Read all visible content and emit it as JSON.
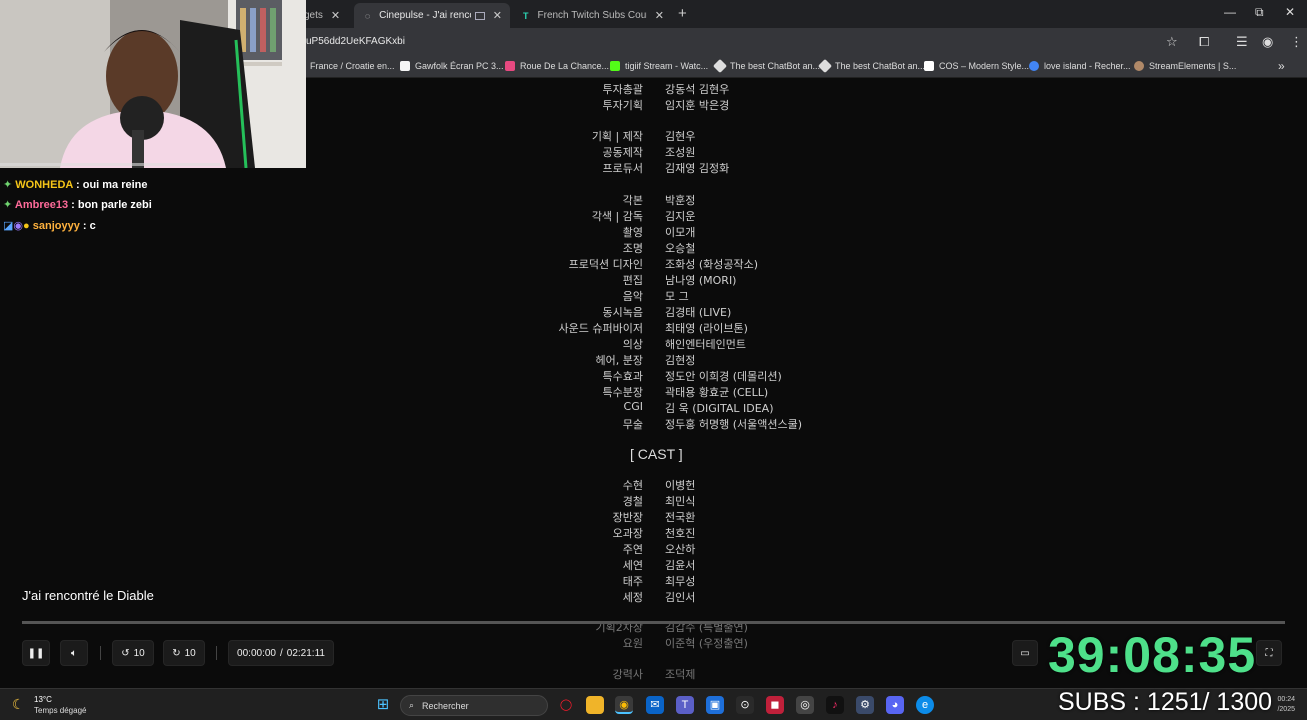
{
  "browser": {
    "tabs": [
      {
        "label": "gets",
        "active": false
      },
      {
        "label": "Cinepulse - J'ai rencontré le",
        "active": true
      },
      {
        "label": "French Twitch Subs Count Stati",
        "active": false
      }
    ],
    "new_tab": "+",
    "window_controls": {
      "minimize": "—",
      "maximize": "⧉",
      "close": "✕"
    },
    "url": "uP56dd2UeKFAGKxbi",
    "bookmarks": [
      {
        "label": "France / Croatie en...",
        "color": "#3b5bdb"
      },
      {
        "label": "Gawfolk Écran PC 3...",
        "color": "#f5f5f5"
      },
      {
        "label": "Roue De La Chance...",
        "color": "#e64980"
      },
      {
        "label": "tigiif Stream - Watc...",
        "color": "#53fc18"
      },
      {
        "label": "The best ChatBot an...",
        "color": "#dddddd"
      },
      {
        "label": "The best ChatBot an...",
        "color": "#dddddd"
      },
      {
        "label": "COS – Modern Style...",
        "color": "#ffffff"
      },
      {
        "label": "love island - Recher...",
        "color": "#4285f4"
      },
      {
        "label": "StreamElements | S...",
        "color": "#b08968"
      }
    ]
  },
  "credits": {
    "crew": [
      {
        "role": "투자총괄",
        "name": "강동석 김현우"
      },
      {
        "role": "투자기획",
        "name": "임지훈 박은경"
      },
      {
        "role": "기획 | 제작",
        "name": "김현우"
      },
      {
        "role": "공동제작",
        "name": "조성원"
      },
      {
        "role": "프로듀서",
        "name": "김재영 김정화"
      },
      {
        "role": "각본",
        "name": "박훈정"
      },
      {
        "role": "각색 | 감독",
        "name": "김지운"
      },
      {
        "role": "촬영",
        "name": "이모개"
      },
      {
        "role": "조명",
        "name": "오승철"
      },
      {
        "role": "프로덕션 디자인",
        "name": "조화성 (화성공작소)"
      },
      {
        "role": "편집",
        "name": "남나영 (MORI)"
      },
      {
        "role": "음악",
        "name": "모 그"
      },
      {
        "role": "동시녹음",
        "name": "김경태 (LIVE)"
      },
      {
        "role": "사운드 슈퍼바이저",
        "name": "최태영 (라이브톤)"
      },
      {
        "role": "의상",
        "name": "해인엔터테인먼트"
      },
      {
        "role": "헤어, 분장",
        "name": "김현정"
      },
      {
        "role": "특수효과",
        "name": "정도안 이희경 (데몰리션)"
      },
      {
        "role": "특수분장",
        "name": "곽태용 황효균 (CELL)"
      },
      {
        "role": "CGI",
        "name": "김 욱 (DIGITAL IDEA)"
      },
      {
        "role": "무술",
        "name": "정두홍 허명행 (서울액션스쿨)"
      }
    ],
    "cast_heading": "[ CAST ]",
    "cast": [
      {
        "role": "수현",
        "name": "이병헌"
      },
      {
        "role": "경철",
        "name": "최민식"
      },
      {
        "role": "장반장",
        "name": "전국환"
      },
      {
        "role": "오과장",
        "name": "천호진"
      },
      {
        "role": "주연",
        "name": "오산하"
      },
      {
        "role": "세연",
        "name": "김윤서"
      },
      {
        "role": "태주",
        "name": "최무성"
      },
      {
        "role": "세정",
        "name": "김인서"
      },
      {
        "role": "기획2차장",
        "name": "김갑수 (특별출연)"
      },
      {
        "role": "요원",
        "name": "이준혁 (우정출연)"
      },
      {
        "role": "강력사",
        "name": "조덕제"
      }
    ]
  },
  "player": {
    "title": "J'ai rencontré le Diable",
    "progress_fraction": 0.0,
    "rewind_label": "10",
    "forward_label": "10",
    "time_current": "00:00:00",
    "time_separator": "/",
    "time_total": "02:21:11",
    "play_pause_icon": "pause-icon",
    "speed_label": "1x"
  },
  "overlay": {
    "chat": [
      {
        "user": "WONHEDA",
        "message": ": oui ma reine",
        "user_color": "#f5c518"
      },
      {
        "user": "Ambree13",
        "message": ": bon parle zebi",
        "user_color": "#ff6b9a"
      },
      {
        "user": "sanjoyyy",
        "message": ": c",
        "user_color": "#ffb23e"
      }
    ],
    "timer": "39:08:35",
    "subs": "SUBS : 1251/ 1300"
  },
  "taskbar": {
    "weather_temp": "13°C",
    "weather_desc": "Temps dégagé",
    "search_placeholder": "Rechercher",
    "clock_time": "00:24",
    "clock_date": "/2025"
  }
}
